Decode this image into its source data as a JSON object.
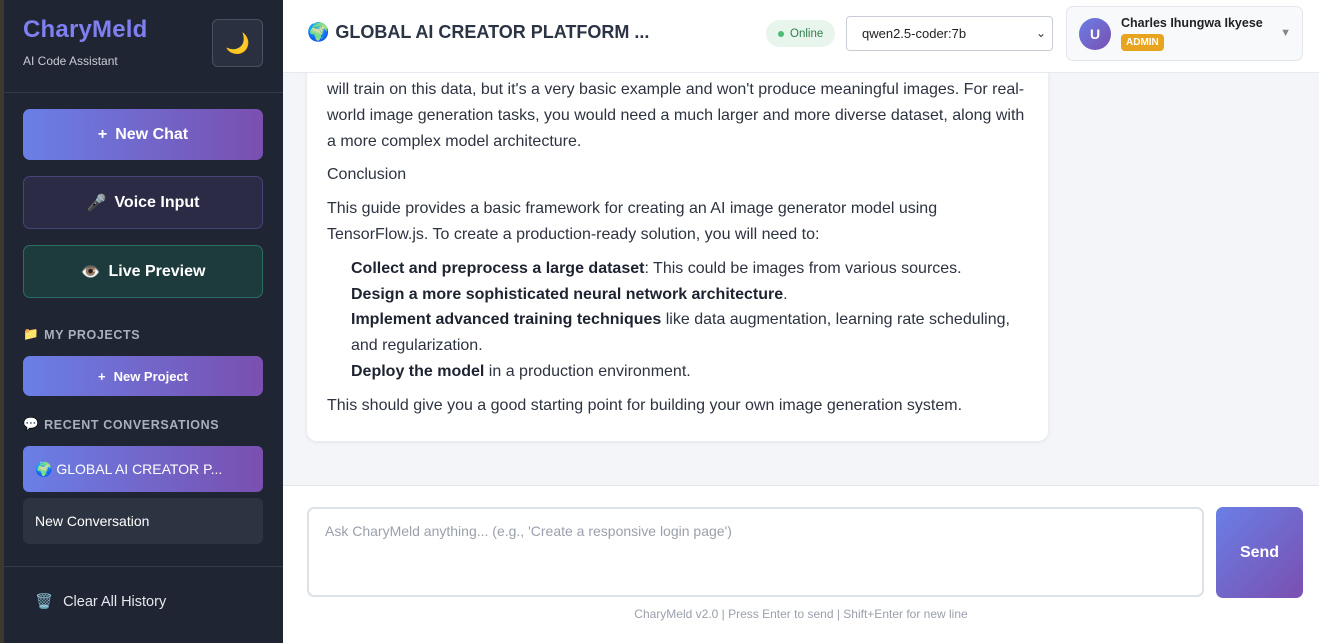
{
  "sidebar": {
    "brand_title": "CharyMeld",
    "brand_subtitle": "AI Code Assistant",
    "theme_icon": "🌙",
    "new_chat_label": "New Chat",
    "voice_input_label": "Voice Input",
    "voice_icon": "🎤",
    "live_preview_label": "Live Preview",
    "preview_icon": "👁️",
    "projects_heading": "MY PROJECTS",
    "projects_icon": "📁",
    "new_project_label": "New Project",
    "recent_heading": "RECENT CONVERSATIONS",
    "recent_icon": "💬",
    "conversations": [
      {
        "label": "🌍 GLOBAL AI CREATOR P...",
        "active": true
      },
      {
        "label": "New Conversation",
        "active": false
      }
    ],
    "clear_history_label": "Clear All History",
    "clear_icon": "🗑️"
  },
  "header": {
    "title": "GLOBAL AI CREATOR PLATFORM ...",
    "title_icon": "🌍",
    "status": "Online",
    "model_selected": "qwen2.5-coder:7b",
    "user_initial": "U",
    "user_name": "Charles Ihungwa Ikyese",
    "user_role": "ADMIN"
  },
  "message": {
    "para1": "will train on this data, but it's a very basic example and won't produce meaningful images. For real-world image generation tasks, you would need a much larger and more diverse dataset, along with a more complex model architecture.",
    "conclusion_heading": "Conclusion",
    "para2": "This guide provides a basic framework for creating an AI image generator model using TensorFlow.js. To create a production-ready solution, you will need to:",
    "list": [
      {
        "bold": "Collect and preprocess a large dataset",
        "rest": ": This could be images from various sources."
      },
      {
        "bold": "Design a more sophisticated neural network architecture",
        "rest": "."
      },
      {
        "bold": "Implement advanced training techniques",
        "rest": " like data augmentation, learning rate scheduling, and regularization."
      },
      {
        "bold": "Deploy the model",
        "rest": " in a production environment."
      }
    ],
    "closing": "This should give you a good starting point for building your own image generation system."
  },
  "composer": {
    "placeholder": "Ask CharyMeld anything... (e.g., 'Create a responsive login page')",
    "send_label": "Send",
    "footer": "CharyMeld v2.0 | Press Enter to send | Shift+Enter for new line"
  },
  "colors": {
    "accent_start": "#6a7fe6",
    "accent_end": "#7a4fb0",
    "sidebar_bg": "#1f2532",
    "status_green": "#4cbb73",
    "admin_badge": "#e8a41f"
  }
}
